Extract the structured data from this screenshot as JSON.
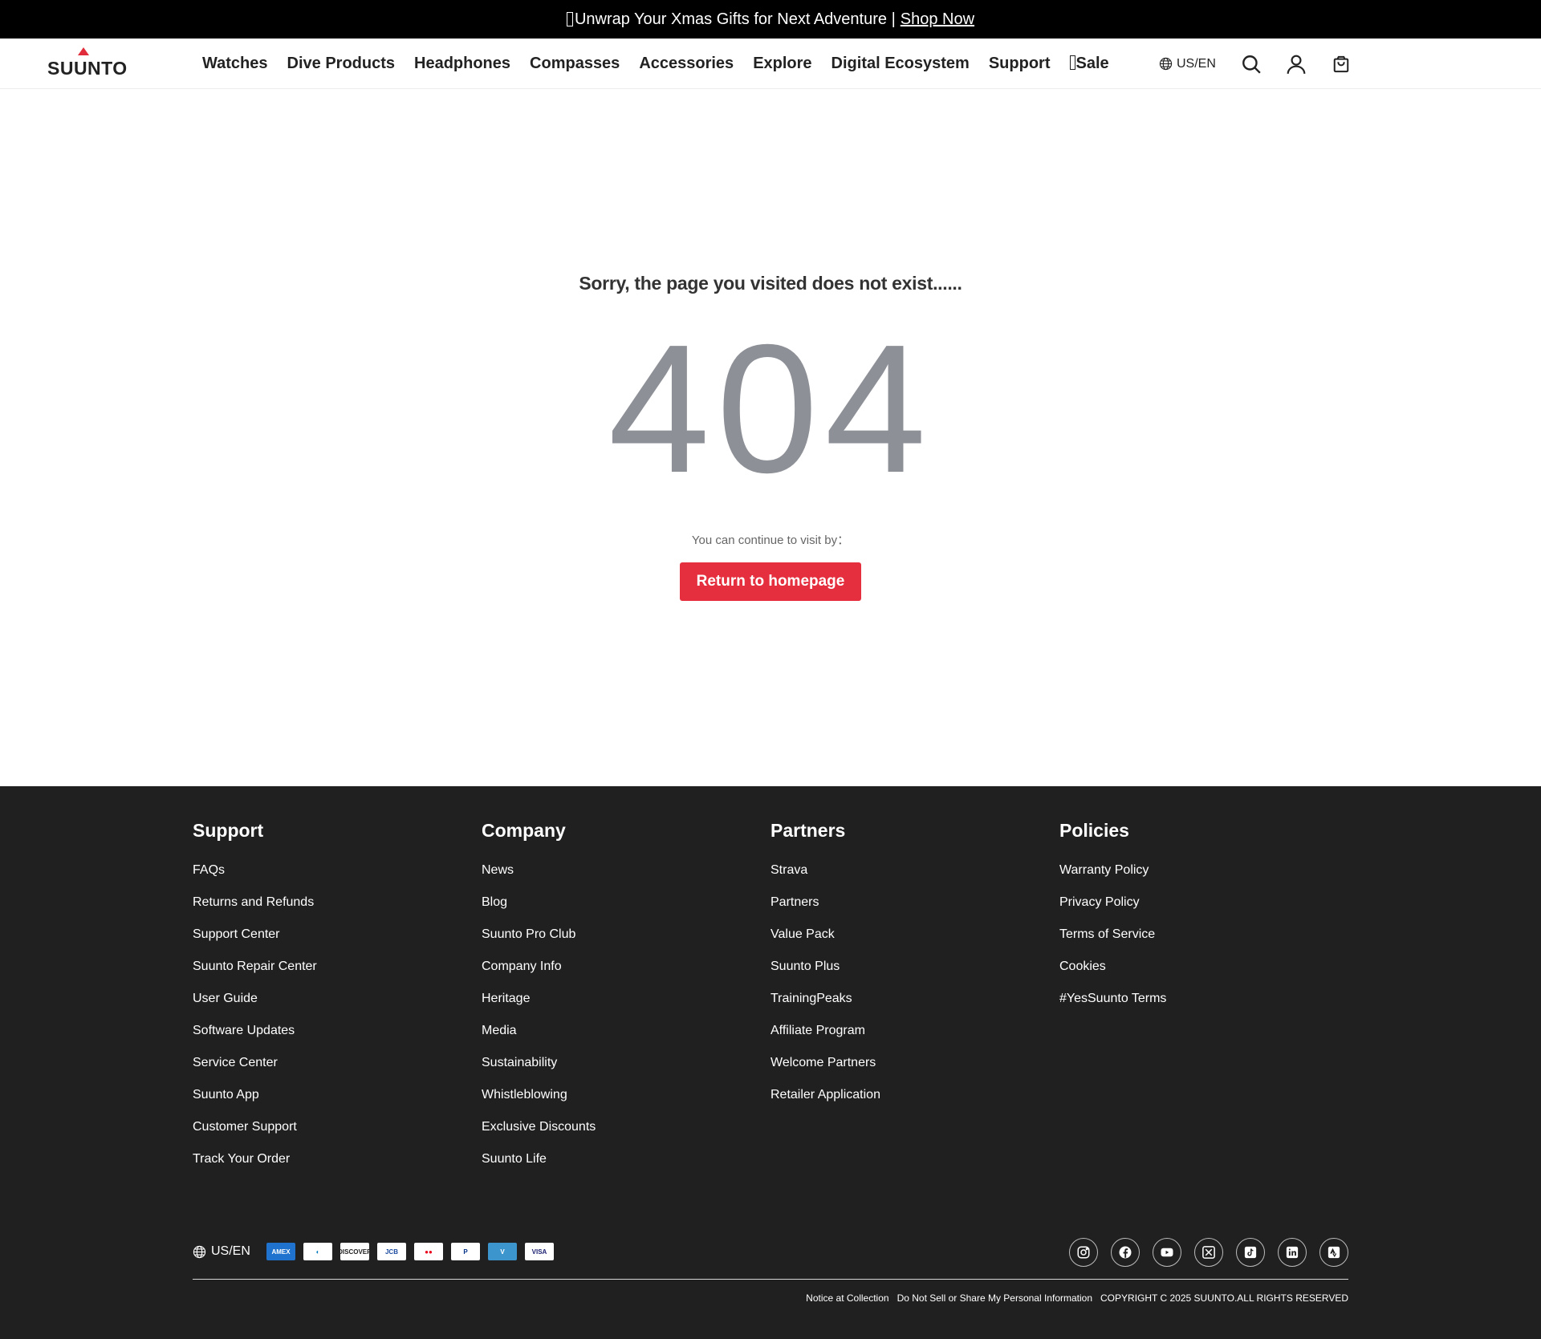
{
  "announcement": {
    "text": "Unwrap Your Xmas Gifts for Next Adventure | ",
    "link": "Shop Now"
  },
  "header": {
    "logo": "SUUNTO",
    "nav": [
      "Watches",
      "Dive Products",
      "Headphones",
      "Compasses",
      "Accessories",
      "Explore",
      "Digital Ecosystem",
      "Support"
    ],
    "sale": "Sale",
    "locale": "US/EN",
    "icons": [
      "globe-icon",
      "search-icon",
      "user-icon",
      "cart-icon"
    ]
  },
  "main": {
    "sorry": "Sorry, the page you visited does not exist......",
    "code": "404",
    "continue": "You can continue to visit by：",
    "button": "Return to homepage"
  },
  "footer": {
    "columns": [
      {
        "title": "Support",
        "links": [
          "FAQs",
          "Returns and Refunds",
          "Support Center",
          "Suunto Repair Center",
          "User Guide",
          "Software Updates",
          "Service Center",
          "Suunto App",
          "Customer Support",
          "Track Your Order"
        ]
      },
      {
        "title": "Company",
        "links": [
          "News",
          "Blog",
          "Suunto Pro Club",
          "Company Info",
          "Heritage",
          "Media",
          "Sustainability",
          "Whistleblowing",
          "Exclusive Discounts",
          "Suunto Life"
        ]
      },
      {
        "title": "Partners",
        "links": [
          "Strava",
          "Partners",
          "Value Pack",
          "Suunto Plus",
          "TrainingPeaks",
          "Affiliate Program",
          "Welcome Partners",
          "Retailer Application"
        ]
      },
      {
        "title": "Policies",
        "links": [
          "Warranty Policy",
          "Privacy Policy",
          "Terms of Service",
          "Cookies",
          "#YesSuunto Terms"
        ]
      }
    ],
    "locale": "US/EN",
    "payments": [
      {
        "name": "amex-icon",
        "label": "AMEX",
        "bg": "#1f72cd",
        "fg": "#ffffff"
      },
      {
        "name": "diners-icon",
        "label": "◐",
        "bg": "#ffffff",
        "fg": "#0079be"
      },
      {
        "name": "discover-icon",
        "label": "DISCOVER",
        "bg": "#ffffff",
        "fg": "#222222"
      },
      {
        "name": "jcb-icon",
        "label": "JCB",
        "bg": "#ffffff",
        "fg": "#1d4ca0"
      },
      {
        "name": "mastercard-icon",
        "label": "●●",
        "bg": "#ffffff",
        "fg": "#eb001b"
      },
      {
        "name": "paypal-icon",
        "label": "P",
        "bg": "#ffffff",
        "fg": "#003087"
      },
      {
        "name": "venmo-icon",
        "label": "V",
        "bg": "#3d95ce",
        "fg": "#ffffff"
      },
      {
        "name": "visa-icon",
        "label": "VISA",
        "bg": "#ffffff",
        "fg": "#1a1f71"
      }
    ],
    "socials": [
      "instagram-icon",
      "facebook-icon",
      "youtube-icon",
      "x-icon",
      "tiktok-icon",
      "linkedin-icon",
      "strava-icon"
    ],
    "legal": {
      "notice": "Notice at Collection",
      "donotsell": "Do Not Sell or Share My Personal Information",
      "copyright": "COPYRIGHT C 2025 SUUNTO.ALL RIGHTS RESERVED"
    }
  },
  "colors": {
    "accent": "#e52f3e",
    "footer_bg": "#202020",
    "code_gray": "#8e9097"
  }
}
